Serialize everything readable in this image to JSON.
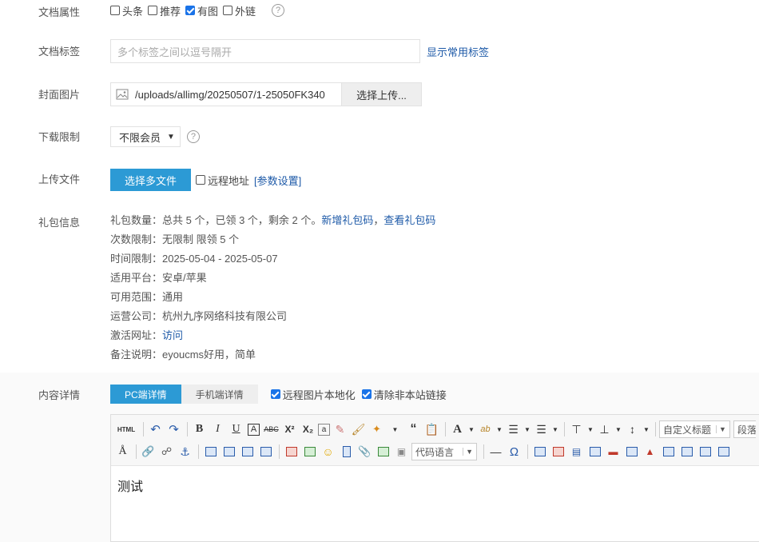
{
  "attrs": {
    "label": "文档属性",
    "options": [
      {
        "label": "头条",
        "checked": false
      },
      {
        "label": "推荐",
        "checked": false
      },
      {
        "label": "有图",
        "checked": true
      },
      {
        "label": "外链",
        "checked": false
      }
    ],
    "help": "?"
  },
  "tags": {
    "label": "文档标签",
    "placeholder": "多个标签之间以逗号隔开",
    "link": "显示常用标签"
  },
  "cover": {
    "label": "封面图片",
    "path": "/uploads/allimg/20250507/1-25050FK340",
    "button": "选择上传..."
  },
  "download": {
    "label": "下载限制",
    "selected": "不限会员",
    "help": "?"
  },
  "upload": {
    "label": "上传文件",
    "button": "选择多文件",
    "remote_label": "远程地址",
    "params_link": "[参数设置]"
  },
  "gift": {
    "label": "礼包信息",
    "count_prefix": "礼包数量：总共 5 个，已领 3 个，剩余 2 个。",
    "add_link": "新增礼包码",
    "comma": "，",
    "view_link": "查看礼包码",
    "times": "次数限制：无限制 限领 5 个",
    "time": "时间限制：2025-05-04 - 2025-05-07",
    "platform": "适用平台：安卓/苹果",
    "scope": "可用范围：通用",
    "company": "运营公司：杭州九序网络科技有限公司",
    "activate_prefix": "激活网址：",
    "activate_link": "访问",
    "remark": "备注说明：eyoucms好用，简单"
  },
  "content": {
    "label": "内容详情",
    "tab_pc": "PC端详情",
    "tab_mobile": "手机端详情",
    "opt_localize": "远程图片本地化",
    "opt_clear_links": "清除非本站链接",
    "localize_checked": true,
    "clear_checked": true
  },
  "editor": {
    "html_btn": "HTML",
    "custom_title": "自定义标题",
    "paragraph": "段落格式",
    "code_lang": "代码语言",
    "body_text": "测试"
  },
  "colors": {
    "accent": "#2c9ad5",
    "link": "#1e5aa8",
    "check": "#1a73e8"
  }
}
